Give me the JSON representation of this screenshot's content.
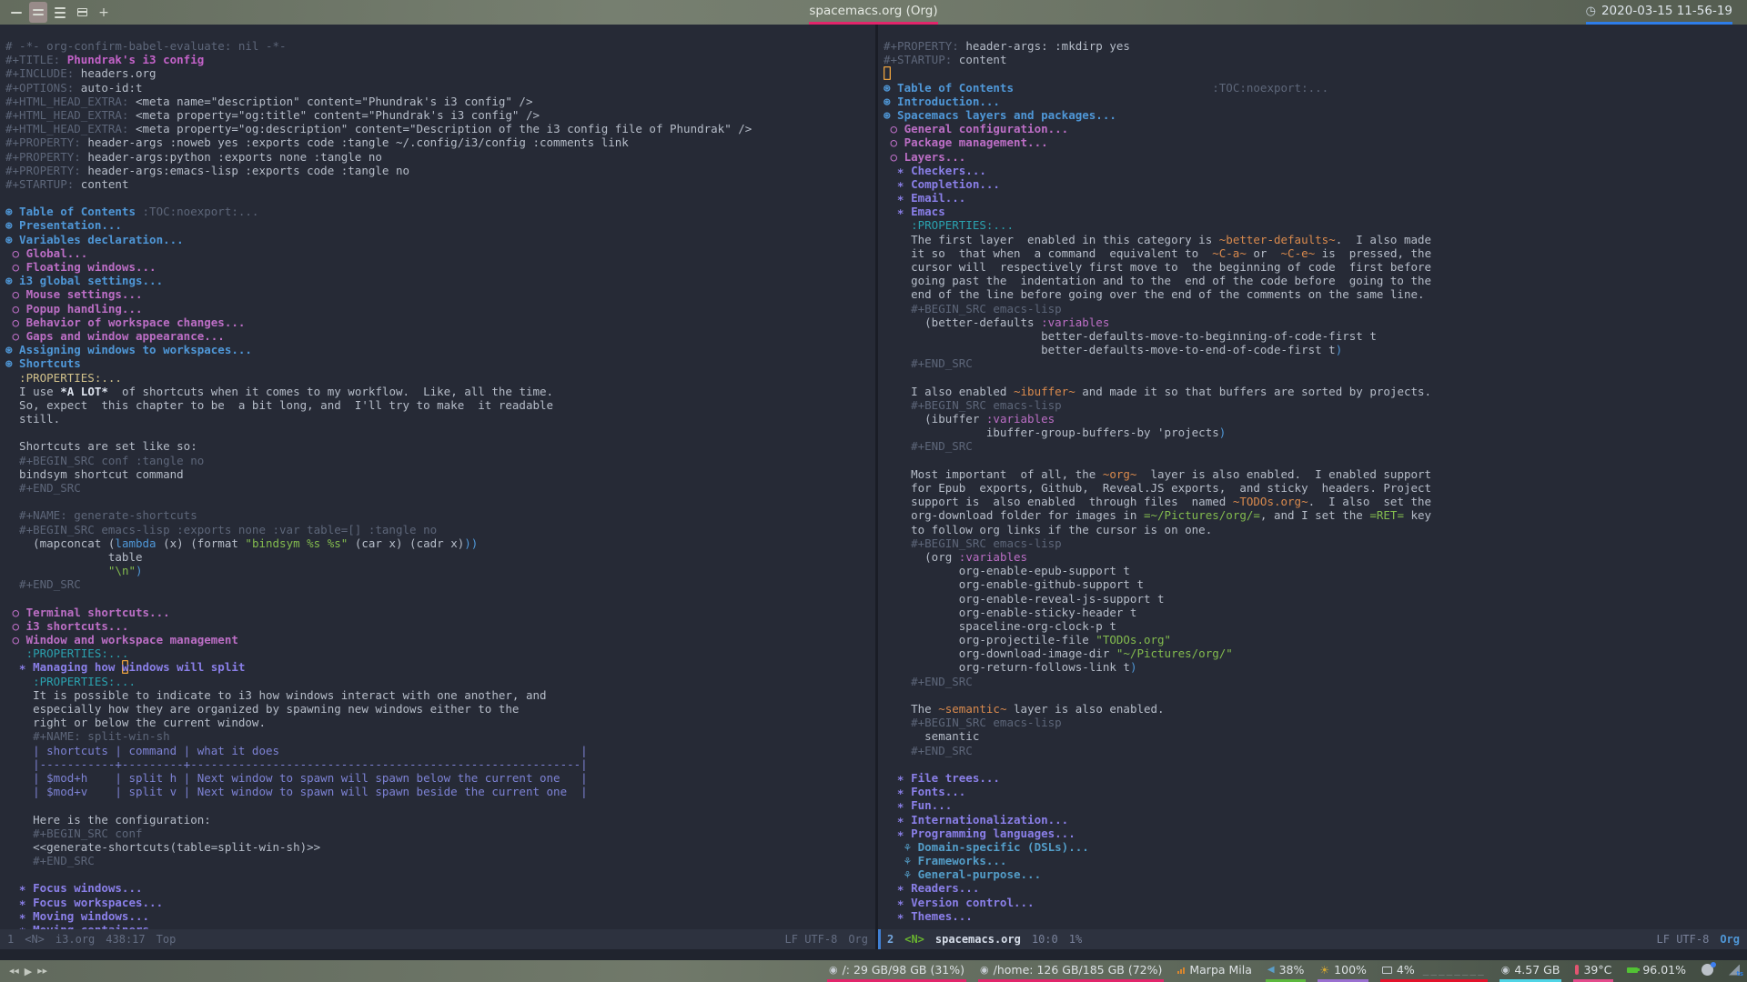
{
  "colors": {
    "accent_blue": "#4f97d7",
    "accent_pink": "#e2256b",
    "clock_underline": "#2e7de9",
    "cursor": "#eba23f",
    "h2_magenta": "#bc6ec5",
    "h3_violet": "#8a7fe8",
    "string_green": "#83bb4e"
  },
  "top_bar": {
    "title": "spacemacs.org (Org)",
    "clock": "2020-03-15 11-56-19",
    "clock_icon": "◷",
    "workspaces": [
      {
        "type": "bars",
        "count": 1,
        "active": false
      },
      {
        "type": "bars",
        "count": 2,
        "active": true
      },
      {
        "type": "bars",
        "count": 3,
        "active": false
      },
      {
        "type": "grid",
        "count": 0,
        "active": false
      },
      {
        "type": "plus",
        "count": 0,
        "active": false
      }
    ]
  },
  "editor": {
    "left_modeline": {
      "win": "1",
      "state": "<N>",
      "buffer": "i3.org",
      "position": "438:17",
      "percent": "Top",
      "eol_encoding": "LF UTF-8",
      "mode": "Org"
    },
    "right_modeline": {
      "win": "2",
      "state": "<N>",
      "buffer": "spacemacs.org",
      "position": "10:0",
      "percent": "1%",
      "eol_encoding": "LF UTF-8",
      "mode": "Org"
    },
    "left_lines": [
      [
        [
          "# -*- org-confirm-babel-evaluate: nil -*-",
          "cm"
        ]
      ],
      [
        [
          "#+TITLE: ",
          "cm"
        ],
        [
          "Phundrak's i3 config",
          "tt"
        ]
      ],
      [
        [
          "#+INCLUDE: ",
          "cm"
        ],
        [
          "headers.org",
          "d"
        ]
      ],
      [
        [
          "#+OPTIONS: ",
          "cm"
        ],
        [
          "auto-id:t",
          "d"
        ]
      ],
      [
        [
          "#+HTML_HEAD_EXTRA: ",
          "cm"
        ],
        [
          "<meta name=\"description\" content=\"Phundrak's i3 config\" />",
          "d"
        ]
      ],
      [
        [
          "#+HTML_HEAD_EXTRA: ",
          "cm"
        ],
        [
          "<meta property=\"og:title\" content=\"Phundrak's i3 config\" />",
          "d"
        ]
      ],
      [
        [
          "#+HTML_HEAD_EXTRA: ",
          "cm"
        ],
        [
          "<meta property=\"og:description\" content=\"Description of the i3 config file of Phundrak\" />",
          "d"
        ]
      ],
      [
        [
          "#+PROPERTY: ",
          "cm"
        ],
        [
          "header-args :noweb yes :exports code :tangle ~/.config/i3/config :comments link",
          "d"
        ]
      ],
      [
        [
          "#+PROPERTY: ",
          "cm"
        ],
        [
          "header-args:python :exports none :tangle no",
          "d"
        ]
      ],
      [
        [
          "#+PROPERTY: ",
          "cm"
        ],
        [
          "header-args:emacs-lisp :exports code :tangle no",
          "d"
        ]
      ],
      [
        [
          "#+STARTUP: ",
          "cm"
        ],
        [
          "content",
          "d"
        ]
      ],
      "",
      [
        [
          "⊛ Table of Contents ",
          "h1"
        ],
        [
          ":TOC:noexport:...",
          "cm"
        ]
      ],
      [
        [
          "⊛ Presentation...",
          "h1"
        ]
      ],
      [
        [
          "⊛ Variables declaration...",
          "h1"
        ]
      ],
      [
        [
          " ○ Global...",
          "h2"
        ]
      ],
      [
        [
          " ○ Floating windows...",
          "h2"
        ]
      ],
      [
        [
          "⊛ i3 global settings...",
          "h1"
        ]
      ],
      [
        [
          " ○ Mouse settings...",
          "h2"
        ]
      ],
      [
        [
          " ○ Popup handling...",
          "h2"
        ]
      ],
      [
        [
          " ○ Behavior of workspace changes...",
          "h2"
        ]
      ],
      [
        [
          " ○ Gaps and window appearance...",
          "h2"
        ]
      ],
      [
        [
          "⊛ Assigning windows to workspaces...",
          "h1"
        ]
      ],
      [
        [
          "⊛ Shortcuts",
          "h1"
        ]
      ],
      [
        [
          "  :PROPERTIES:...",
          "drk"
        ]
      ],
      [
        [
          "  I use ",
          "d"
        ],
        [
          "*A LOT*",
          "b"
        ],
        [
          "  of shortcuts when it comes to my workflow.  Like, all the time.",
          "d"
        ]
      ],
      [
        [
          "  So, expect  this chapter to be  a bit long, and  I'll try to make  it readable",
          "d"
        ]
      ],
      [
        [
          "  still.",
          "d"
        ]
      ],
      "",
      [
        [
          "  Shortcuts are set like so:",
          "d"
        ]
      ],
      [
        [
          "  #+BEGIN_SRC conf :tangle no",
          "cm"
        ]
      ],
      [
        [
          "  bindsym shortcut command",
          "d"
        ]
      ],
      [
        [
          "  #+END_SRC",
          "cm"
        ]
      ],
      "",
      [
        [
          "  #+NAME: generate-shortcuts",
          "cm"
        ]
      ],
      [
        [
          "  #+BEGIN_SRC emacs-lisp :exports none :var table=[] :tangle no",
          "cm"
        ]
      ],
      [
        [
          "    (mapconcat (",
          "d"
        ],
        [
          "lambda",
          "fb"
        ],
        [
          " (x) (format ",
          "d"
        ],
        [
          "\"bindsym %s %s\"",
          "st"
        ],
        [
          " (car x) (cadr x)",
          "d"
        ],
        [
          "))",
          "pb"
        ]
      ],
      [
        [
          "               table",
          "d"
        ]
      ],
      [
        [
          "               ",
          "d"
        ],
        [
          "\"\\n\"",
          "st"
        ],
        [
          ")",
          "pb"
        ]
      ],
      [
        [
          "  #+END_SRC",
          "cm"
        ]
      ],
      "",
      [
        [
          " ○ Terminal shortcuts...",
          "h2"
        ]
      ],
      [
        [
          " ○ i3 shortcuts...",
          "h2"
        ]
      ],
      [
        [
          " ○ Window and workspace management",
          "h2"
        ]
      ],
      [
        [
          "   :PROPERTIES:...",
          "dr"
        ]
      ],
      [
        [
          "  ∗ Managing how ",
          "h3"
        ],
        [
          "w",
          "h3 cur"
        ],
        [
          "indows will split",
          "h3"
        ]
      ],
      [
        [
          "    :PROPERTIES:...",
          "dr"
        ]
      ],
      [
        [
          "    It is possible to indicate to i3 how windows interact with one another, and",
          "d"
        ]
      ],
      [
        [
          "    especially how they are organized by spawning new windows either to the",
          "d"
        ]
      ],
      [
        [
          "    right or below the current window.",
          "d"
        ]
      ],
      [
        [
          "    #+NAME: split-win-sh",
          "cm"
        ]
      ],
      [
        [
          "    | shortcuts | command | what it does                                            |",
          "tb"
        ]
      ],
      [
        [
          "    |-----------+---------+---------------------------------------------------------|",
          "tb"
        ]
      ],
      [
        [
          "    | $mod+h    | split h | Next window to spawn will spawn below the current one   |",
          "tb"
        ]
      ],
      [
        [
          "    | $mod+v    | split v | Next window to spawn will spawn beside the current one  |",
          "tb"
        ]
      ],
      "",
      [
        [
          "    Here is the configuration:",
          "d"
        ]
      ],
      [
        [
          "    #+BEGIN_SRC conf",
          "cm"
        ]
      ],
      [
        [
          "    <<generate-shortcuts(table=split-win-sh)>>",
          "d"
        ]
      ],
      [
        [
          "    #+END_SRC",
          "cm"
        ]
      ],
      "",
      [
        [
          "  ∗ Focus windows...",
          "h3"
        ]
      ],
      [
        [
          "  ∗ Focus workspaces...",
          "h3"
        ]
      ],
      [
        [
          "  ∗ Moving windows...",
          "h3"
        ]
      ],
      [
        [
          "  ∗ Moving containers...",
          "h3"
        ]
      ]
    ],
    "right_lines": [
      [
        [
          "#+PROPERTY: ",
          "cm"
        ],
        [
          "header-args: :mkdirp yes",
          "d"
        ]
      ],
      [
        [
          "#+STARTUP: ",
          "cm"
        ],
        [
          "content",
          "d"
        ]
      ],
      [
        [
          " ",
          "cur"
        ]
      ],
      [
        [
          "⊛ Table of Contents",
          "h1"
        ],
        [
          "                             :TOC:noexport:...",
          "cm"
        ]
      ],
      [
        [
          "⊛ Introduction...",
          "h1"
        ]
      ],
      [
        [
          "⊛ Spacemacs layers and packages...",
          "h1"
        ]
      ],
      [
        [
          " ○ General configuration...",
          "h2"
        ]
      ],
      [
        [
          " ○ Package management...",
          "h2"
        ]
      ],
      [
        [
          " ○ Layers...",
          "h2"
        ]
      ],
      [
        [
          "  ∗ Checkers...",
          "h3"
        ]
      ],
      [
        [
          "  ∗ Completion...",
          "h3"
        ]
      ],
      [
        [
          "  ∗ Email...",
          "h3"
        ]
      ],
      [
        [
          "  ∗ Emacs",
          "h3"
        ]
      ],
      [
        [
          "    :PROPERTIES:...",
          "dr"
        ]
      ],
      [
        [
          "    The first layer  enabled in this category is ",
          "d"
        ],
        [
          "~better-defaults~",
          "cd"
        ],
        [
          ".  I also made",
          "d"
        ]
      ],
      [
        [
          "    it so  that when  a command  equivalent to  ",
          "d"
        ],
        [
          "~C-a~",
          "cd"
        ],
        [
          " or  ",
          "d"
        ],
        [
          "~C-e~",
          "cd"
        ],
        [
          " is  pressed, the",
          "d"
        ]
      ],
      [
        [
          "    cursor will  respectively first move to  the beginning of code  first before",
          "d"
        ]
      ],
      [
        [
          "    going past the  indentation and to the  end of the code before  going to the",
          "d"
        ]
      ],
      [
        [
          "    end of the line before going over the end of the comments on the same line.",
          "d"
        ]
      ],
      [
        [
          "    #+BEGIN_SRC emacs-lisp",
          "cm"
        ]
      ],
      [
        [
          "      (better-defaults ",
          "d"
        ],
        [
          ":variables",
          "fk"
        ]
      ],
      [
        [
          "                       better-defaults-move-to-beginning-of-code-first t",
          "d"
        ]
      ],
      [
        [
          "                       better-defaults-move-to-end-of-code-first t",
          "d"
        ],
        [
          ")",
          "pb"
        ]
      ],
      [
        [
          "    #+END_SRC",
          "cm"
        ]
      ],
      "",
      [
        [
          "    I also enabled ",
          "d"
        ],
        [
          "~ibuffer~",
          "cd"
        ],
        [
          " and made it so that buffers are sorted by projects.",
          "d"
        ]
      ],
      [
        [
          "    #+BEGIN_SRC emacs-lisp",
          "cm"
        ]
      ],
      [
        [
          "      (ibuffer ",
          "d"
        ],
        [
          ":variables",
          "fk"
        ]
      ],
      [
        [
          "               ibuffer-group-buffers-by 'projects",
          "d"
        ],
        [
          ")",
          "pb"
        ]
      ],
      [
        [
          "    #+END_SRC",
          "cm"
        ]
      ],
      "",
      [
        [
          "    Most important  of all, the ",
          "d"
        ],
        [
          "~org~",
          "cd"
        ],
        [
          "  layer is also enabled.  I enabled support",
          "d"
        ]
      ],
      [
        [
          "    for Epub  exports, Github,  Reveal.JS exports,  and sticky  headers. Project",
          "d"
        ]
      ],
      [
        [
          "    support is  also enabled  through files  named ",
          "d"
        ],
        [
          "~TODOs.org~",
          "cd"
        ],
        [
          ".  I also  set the",
          "d"
        ]
      ],
      [
        [
          "    org-download folder for images in ",
          "d"
        ],
        [
          "=~/Pictures/org/=",
          "vb"
        ],
        [
          ", and I set the ",
          "d"
        ],
        [
          "=RET=",
          "vb"
        ],
        [
          " key",
          "d"
        ]
      ],
      [
        [
          "    to follow org links if the cursor is on one.",
          "d"
        ]
      ],
      [
        [
          "    #+BEGIN_SRC emacs-lisp",
          "cm"
        ]
      ],
      [
        [
          "      (org ",
          "d"
        ],
        [
          ":variables",
          "fk"
        ]
      ],
      [
        [
          "           org-enable-epub-support t",
          "d"
        ]
      ],
      [
        [
          "           org-enable-github-support t",
          "d"
        ]
      ],
      [
        [
          "           org-enable-reveal-js-support t",
          "d"
        ]
      ],
      [
        [
          "           org-enable-sticky-header t",
          "d"
        ]
      ],
      [
        [
          "           spaceline-org-clock-p t",
          "d"
        ]
      ],
      [
        [
          "           org-projectile-file ",
          "d"
        ],
        [
          "\"TODOs.org\"",
          "st"
        ]
      ],
      [
        [
          "           org-download-image-dir ",
          "d"
        ],
        [
          "\"~/Pictures/org/\"",
          "st"
        ]
      ],
      [
        [
          "           org-return-follows-link t",
          "d"
        ],
        [
          ")",
          "pb"
        ]
      ],
      [
        [
          "    #+END_SRC",
          "cm"
        ]
      ],
      "",
      [
        [
          "    The ",
          "d"
        ],
        [
          "~semantic~",
          "cd"
        ],
        [
          " layer is also enabled.",
          "d"
        ]
      ],
      [
        [
          "    #+BEGIN_SRC emacs-lisp",
          "cm"
        ]
      ],
      [
        [
          "      semantic",
          "d"
        ]
      ],
      [
        [
          "    #+END_SRC",
          "cm"
        ]
      ],
      "",
      [
        [
          "  ∗ File trees...",
          "h3"
        ]
      ],
      [
        [
          "  ∗ Fonts...",
          "h3"
        ]
      ],
      [
        [
          "  ∗ Fun...",
          "h3"
        ]
      ],
      [
        [
          "  ∗ Internationalization...",
          "h3"
        ]
      ],
      [
        [
          "  ∗ Programming languages...",
          "h3"
        ]
      ],
      [
        [
          "   ⚘ Domain-specific (DSLs)...",
          "h4"
        ]
      ],
      [
        [
          "   ⚘ Frameworks...",
          "h4"
        ]
      ],
      [
        [
          "   ⚘ General-purpose...",
          "h4"
        ]
      ],
      [
        [
          "  ∗ Readers...",
          "h3"
        ]
      ],
      [
        [
          "  ∗ Version control...",
          "h3"
        ]
      ],
      [
        [
          "  ∗ Themes...",
          "h3"
        ]
      ]
    ]
  },
  "bottom_bar": {
    "media": [
      {
        "id": "prev",
        "glyph": "◀◀"
      },
      {
        "id": "play",
        "glyph": "▶"
      },
      {
        "id": "next",
        "glyph": "▶▶"
      }
    ],
    "modules": [
      {
        "id": "disk-root",
        "icon": "disk",
        "text": "/: 29 GB/98 GB (31%)",
        "underline": "#e2256b"
      },
      {
        "id": "disk-home",
        "icon": "disk",
        "text": "/home: 126 GB/185 GB (72%)",
        "underline": "#e2256b"
      },
      {
        "id": "wifi-network",
        "icon": "signal",
        "text": "Marpa Mila",
        "underline": null
      },
      {
        "id": "volume",
        "icon": "volume",
        "text": "38%",
        "underline": "#5cb83e"
      },
      {
        "id": "brightness",
        "icon": "sun",
        "text": "100%",
        "underline": "#9a70d0"
      },
      {
        "id": "cpu",
        "icon": "cpu",
        "text": "4%",
        "graph": "________",
        "underline": "#e3122b"
      },
      {
        "id": "memory",
        "icon": "disk",
        "text": "4.57 GB",
        "underline": "#50d5e6"
      },
      {
        "id": "temperature",
        "icon": "thermo",
        "text": "39°C",
        "underline": "#e34b8b"
      },
      {
        "id": "battery",
        "icon": "battery",
        "text": "96.01%",
        "underline": null
      },
      {
        "id": "discord",
        "icon": "discord",
        "text": "",
        "underline": null,
        "badge": "dot"
      },
      {
        "id": "network-tray",
        "icon": "wifi",
        "text": "",
        "underline": null,
        "badge": "ts"
      }
    ]
  }
}
